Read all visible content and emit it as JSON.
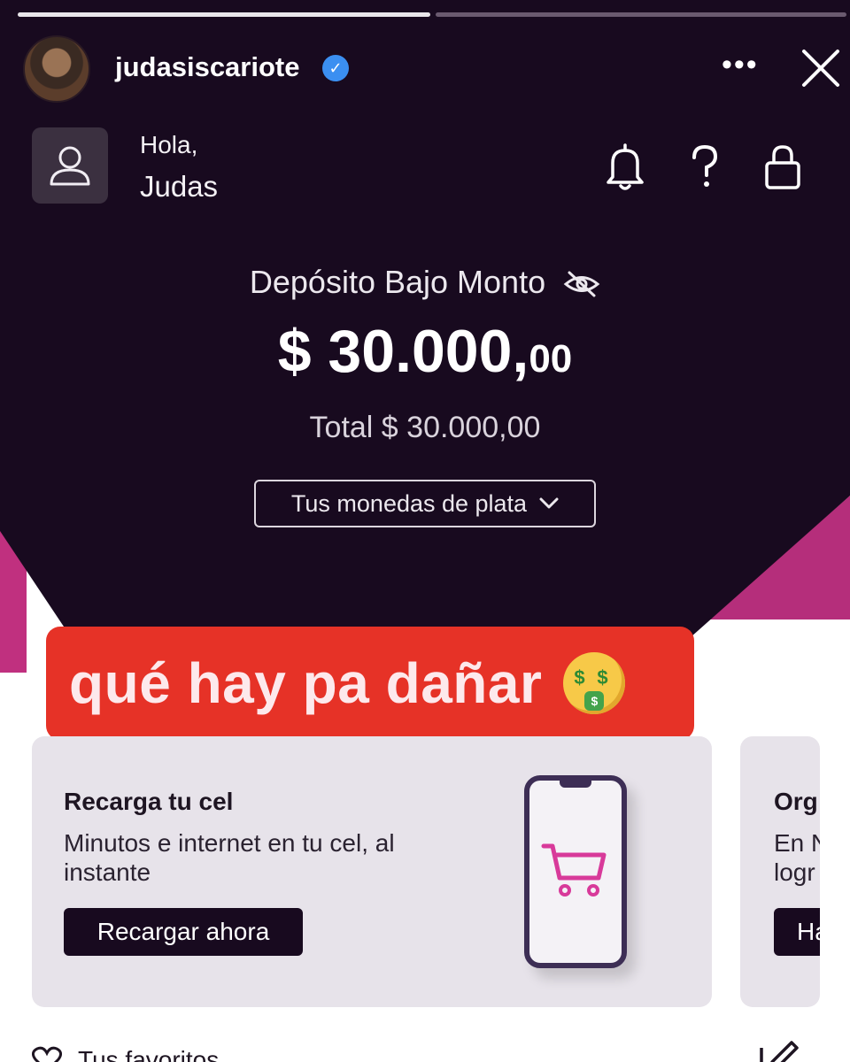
{
  "story": {
    "username": "judasiscariote",
    "verified_icon": "verified-badge-icon",
    "more_label": "•••"
  },
  "app": {
    "greeting": "Hola,",
    "user_name": "Judas",
    "account_label": "Depósito Bajo Monto",
    "balance_main": "$ 30.000,",
    "balance_cents": "00",
    "total": "Total $ 30.000,00",
    "currency_selector": "Tus monedas de plata",
    "colors": {
      "background": "#180a1f",
      "accent": "#c0307f"
    }
  },
  "sticker": {
    "text": "qué hay pa dañar"
  },
  "cards": [
    {
      "title": "Recarga tu cel",
      "description": "Minutos e internet en tu cel, al instante",
      "button": "Recargar ahora"
    },
    {
      "title": "Org",
      "description": "En N\nlogr",
      "button": "Ha"
    }
  ],
  "favorites": {
    "label": "Tus favoritos"
  }
}
